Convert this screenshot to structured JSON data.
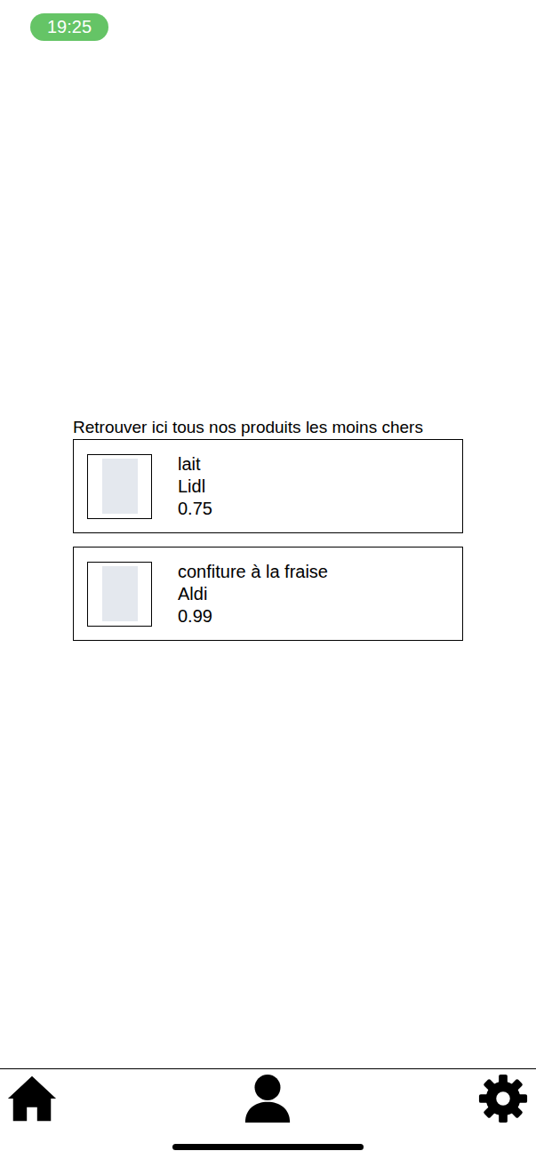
{
  "status_bar": {
    "time": "19:25"
  },
  "heading": "Retrouver ici tous nos produits les moins chers",
  "products": [
    {
      "name": "lait",
      "store": "Lidl",
      "price": "0.75"
    },
    {
      "name": "confiture à la fraise",
      "store": "Aldi",
      "price": "0.99"
    }
  ]
}
